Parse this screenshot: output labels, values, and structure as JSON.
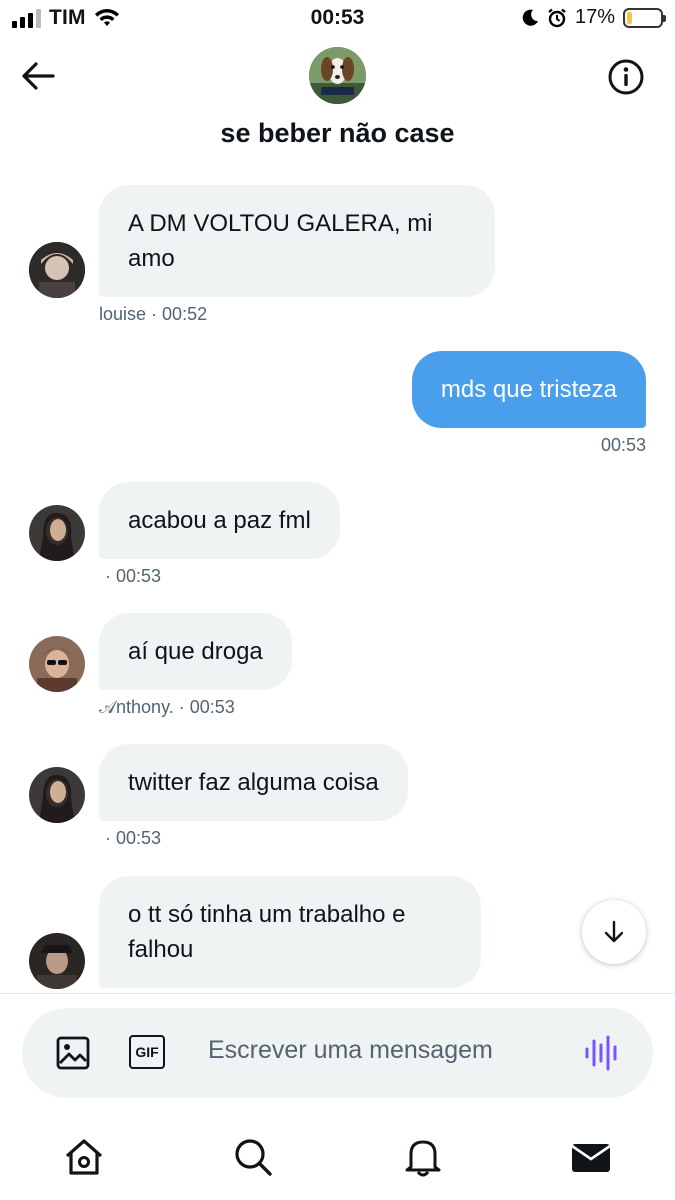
{
  "status_bar": {
    "carrier": "TIM",
    "time": "00:53",
    "battery": "17%",
    "battery_level": 0.17
  },
  "header": {
    "title": "se beber não case"
  },
  "messages": [
    {
      "text": "A DM VOLTOU GALERA, mi amo",
      "author": "louise",
      "time": "· 00:52",
      "type": "received"
    },
    {
      "text": "mds que tristeza",
      "time": "00:53",
      "type": "sent"
    },
    {
      "text": "acabou a paz fml",
      "author": "",
      "time": "· 00:53",
      "type": "received"
    },
    {
      "text": "aí que droga",
      "author": "𝒜nthony.",
      "time": "· 00:53",
      "type": "received"
    },
    {
      "text": "twitter faz alguma coisa",
      "author": "",
      "time": "· 00:53",
      "type": "received"
    },
    {
      "text": "o tt só tinha um trabalho e falhou",
      "author": "",
      "time": "",
      "type": "received"
    }
  ],
  "composer": {
    "placeholder": "Escrever uma mensagem",
    "gif_label": "GIF"
  },
  "icons": {
    "back": "arrow-left-icon",
    "info": "info-icon",
    "image": "image-icon",
    "gif": "gif-icon",
    "voice": "voice-icon",
    "scroll": "arrow-down-icon",
    "home": "home-icon",
    "search": "search-icon",
    "notifications": "bell-icon",
    "messages": "mail-icon"
  },
  "colors": {
    "sent_bubble": "#4a9fec",
    "received_bubble": "#eff3f4",
    "accent_voice": "#7856ff",
    "text": "#0f1419",
    "meta": "#536471"
  }
}
